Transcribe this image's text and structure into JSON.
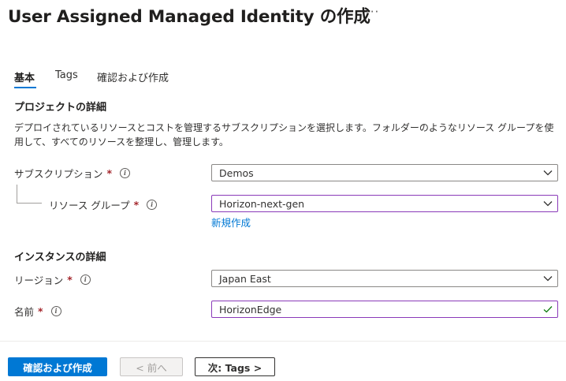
{
  "header": {
    "title": "User Assigned Managed Identity の作成",
    "more_label": "···"
  },
  "tabs": [
    {
      "label": "基本",
      "active": true
    },
    {
      "label": "Tags",
      "active": false
    },
    {
      "label": "確認および作成",
      "active": false
    }
  ],
  "project": {
    "heading": "プロジェクトの詳細",
    "description": "デプロイされているリソースとコストを管理するサブスクリプションを選択します。フォルダーのようなリソース グループを使用して、すべてのリソースを整理し、管理します。",
    "subscription": {
      "label": "サブスクリプション",
      "required": "*",
      "value": "Demos"
    },
    "resource_group": {
      "label": "リソース グループ",
      "required": "*",
      "value": "Horizon-next-gen"
    },
    "create_new_link": "新規作成"
  },
  "instance": {
    "heading": "インスタンスの詳細",
    "region": {
      "label": "リージョン",
      "required": "*",
      "value": "Japan East"
    },
    "name": {
      "label": "名前",
      "required": "*",
      "value": "HorizonEdge"
    }
  },
  "footer": {
    "review_create": "確認および作成",
    "previous": "< 前へ",
    "next": "次: Tags >"
  },
  "colors": {
    "accent": "#0078d4",
    "focus_border": "#8a3ab9",
    "required": "#a4262c",
    "valid": "#107c10"
  },
  "icons": {
    "info": "info-icon",
    "chevron": "chevron-down-icon",
    "check": "checkmark-icon",
    "more": "more-icon"
  }
}
